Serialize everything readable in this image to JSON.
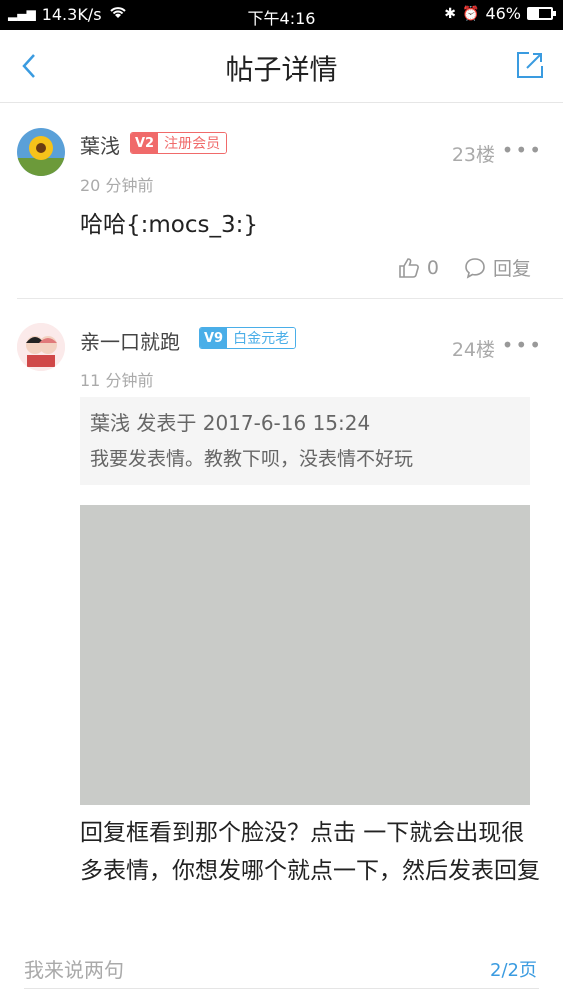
{
  "status_bar": {
    "signal": "2G",
    "speed": "14.3K/s",
    "time": "下午4:16",
    "battery": "46%",
    "battery_fraction": 0.46
  },
  "nav": {
    "title": "帖子详情"
  },
  "posts": [
    {
      "username": "葉浅",
      "level": "V2",
      "level_title": "注册会员",
      "floor": "23楼",
      "more": "•••",
      "time": "20 分钟前",
      "content": "哈哈{:mocs_3:}",
      "likes": "0",
      "reply_label": "回复"
    },
    {
      "username": "亲一口就跑",
      "level": "V9",
      "level_title": "白金元老",
      "floor": "24楼",
      "more": "•••",
      "time": "11 分钟前",
      "quote_header": "葉浅 发表于 2017-6-16 15:24",
      "quote_body": "我要发表情。教教下呗，没表情不好玩",
      "reply": "回复框看到那个脸没？点击 一下就会出现很多表情，你想发哪个就点一下，然后发表回复"
    }
  ],
  "bottom": {
    "placeholder": "我来说两句",
    "page": "2/2页"
  },
  "colors": {
    "accent": "#3a9be0",
    "v2_badge": "#f06a6a",
    "v9_badge": "#4aaee8"
  }
}
